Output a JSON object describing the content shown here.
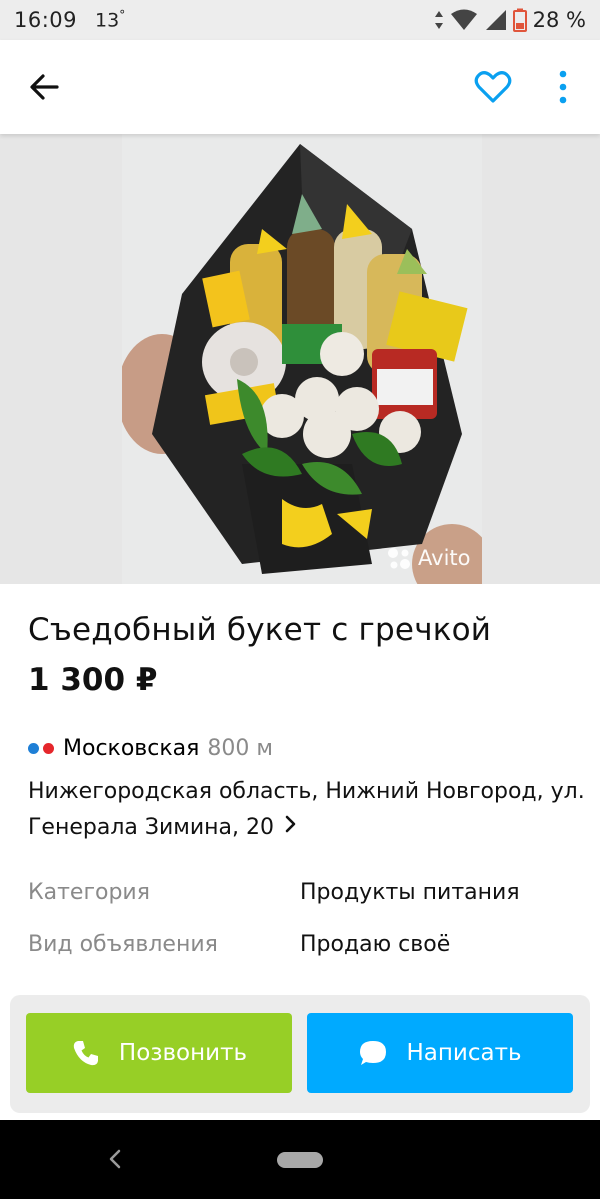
{
  "status_bar": {
    "time": "16:09",
    "temperature": "13",
    "degree": "°",
    "battery": "28 %"
  },
  "app_bar": {
    "back_icon": "arrow-left-icon",
    "favorite_icon": "heart-outline-icon",
    "more_icon": "more-vertical-icon",
    "favorite_color": "#0aa0f0"
  },
  "photo": {
    "watermark": "Avito",
    "description_icons": [
      "bouquet-image"
    ]
  },
  "listing": {
    "title": "Съедобный букет с гречкой",
    "price": "1 300 ₽",
    "metro": {
      "station": "Московская",
      "distance": "800 м",
      "line_colors": [
        "#1e7fd6",
        "#e5262b"
      ]
    },
    "address": "Нижегородская область, Нижний Новгород, ул. Генерала Зимина, 20",
    "params": [
      {
        "label": "Категория",
        "value": "Продукты питания"
      },
      {
        "label": "Вид объявления",
        "value": "Продаю своё"
      }
    ]
  },
  "actions": {
    "call_label": "Позвонить",
    "write_label": "Написать",
    "call_color": "#97cf26",
    "write_color": "#00aaff"
  }
}
